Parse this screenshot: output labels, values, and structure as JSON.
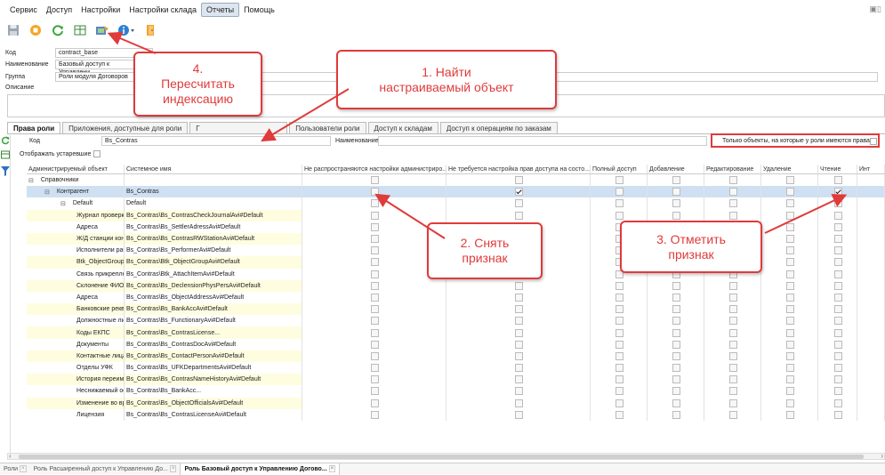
{
  "menu": [
    "Сервис",
    "Доступ",
    "Настройки",
    "Настройки склада",
    "Отчеты",
    "Помощь"
  ],
  "menu_active": "Отчеты",
  "toolbar_icons": [
    "save-icon",
    "stop-icon",
    "refresh-icon",
    "table-icon",
    "reindex-icon",
    "info-icon",
    "door-icon"
  ],
  "form": {
    "code_label": "Код",
    "code_value": "contract_base",
    "name_label": "Наименование",
    "name_value": "Базовый доступ к Управлени",
    "group_label": "Группа",
    "group_value": "Роли модуля Договоров",
    "desc_label": "Описание"
  },
  "tabs": [
    "Права роли",
    "Приложения, доступные для роли",
    "Г",
    "Пользователи роли",
    "Доступ к складам",
    "Доступ к операциям по заказам"
  ],
  "filter": {
    "code_label": "Код",
    "code_value": "Bs_Contras",
    "name_label": "Наименование",
    "only_objects_label": "Только объекты, на которые у роли имеются права",
    "show_outdated_label": "Отображать устаревшие"
  },
  "columns": [
    "Администрируемый объект",
    "Системное имя",
    "Не распространяются настройки администриро...",
    "Не требуется настройка прав доступа на состо...",
    "Полный доступ",
    "Добавление",
    "Редактирование",
    "Удаление",
    "Чтение",
    "Инт"
  ],
  "rows": [
    {
      "name": "Справочники",
      "sys": "",
      "indent": 0,
      "expand": "⊟",
      "cbs": [
        0,
        0,
        0,
        0,
        0,
        0,
        0
      ],
      "style": "plain"
    },
    {
      "name": "Контрагент",
      "sys": "Bs_Contras",
      "indent": 1,
      "expand": "⊟",
      "cbs": [
        0,
        1,
        0,
        0,
        0,
        0,
        1
      ],
      "style": "sel"
    },
    {
      "name": "Default",
      "sys": "Default",
      "indent": 2,
      "expand": "⊟",
      "cbs": [
        0,
        0,
        0,
        0,
        0,
        0,
        0
      ],
      "style": "plain"
    },
    {
      "name": "Журнал проверки конт",
      "sys": "Bs_Contras\\Bs_ContrasCheckJournalAvi#Default",
      "indent": 3,
      "expand": "",
      "cbs": [
        0,
        0,
        0,
        0,
        0,
        0,
        0
      ],
      "style": "yellow"
    },
    {
      "name": "Адреса",
      "sys": "Bs_Contras\\Bs_SettlerAdressAvi#Default",
      "indent": 3,
      "expand": "",
      "cbs": [
        0,
        0,
        0,
        0,
        0,
        0,
        0
      ],
      "style": "plain"
    },
    {
      "name": "Ж/Д станции контраген",
      "sys": "Bs_Contras\\Bs_ContrasRWStationAvi#Default",
      "indent": 3,
      "expand": "",
      "cbs": [
        0,
        0,
        0,
        0,
        0,
        0,
        0
      ],
      "style": "yellow"
    },
    {
      "name": "Исполнители работ",
      "sys": "Bs_Contras\\Bs_PerformerAvi#Default",
      "indent": 3,
      "expand": "",
      "cbs": [
        0,
        0,
        0,
        0,
        0,
        0,
        0
      ],
      "style": "plain"
    },
    {
      "name": "Btk_ObjectGroupAvi#Def",
      "sys": "Bs_Contras\\Btk_ObjectGroupAvi#Default",
      "indent": 3,
      "expand": "",
      "cbs": [
        0,
        0,
        0,
        0,
        0,
        0,
        0
      ],
      "style": "yellow"
    },
    {
      "name": "Связь прикрепленного",
      "sys": "Bs_Contras\\Btk_AttachItemAvi#Default",
      "indent": 3,
      "expand": "",
      "cbs": [
        0,
        0,
        0,
        0,
        0,
        0,
        0
      ],
      "style": "plain"
    },
    {
      "name": "Склонение ФИО физич",
      "sys": "Bs_Contras\\Bs_DeclensionPhysPersAvi#Default",
      "indent": 3,
      "expand": "",
      "cbs": [
        0,
        0,
        0,
        0,
        0,
        0,
        0
      ],
      "style": "yellow"
    },
    {
      "name": "Адреса",
      "sys": "Bs_Contras\\Bs_ObjectAddressAvi#Default",
      "indent": 3,
      "expand": "",
      "cbs": [
        0,
        0,
        0,
        0,
        0,
        0,
        0
      ],
      "style": "plain"
    },
    {
      "name": "Банковские реквизиты",
      "sys": "Bs_Contras\\Bs_BankAccAvi#Default",
      "indent": 3,
      "expand": "",
      "cbs": [
        0,
        0,
        0,
        0,
        0,
        0,
        0
      ],
      "style": "yellow"
    },
    {
      "name": "Должностные лица",
      "sys": "Bs_Contras\\Bs_FunctionaryAvi#Default",
      "indent": 3,
      "expand": "",
      "cbs": [
        0,
        0,
        0,
        0,
        0,
        0,
        0
      ],
      "style": "plain"
    },
    {
      "name": "Коды ЕКПС",
      "sys": "Bs_Contras\\Bs_ContrasLicense...",
      "indent": 3,
      "expand": "",
      "cbs": [
        0,
        0,
        0,
        0,
        0,
        0,
        0
      ],
      "style": "yellow"
    },
    {
      "name": "Документы",
      "sys": "Bs_Contras\\Bs_ContrasDocAvi#Default",
      "indent": 3,
      "expand": "",
      "cbs": [
        0,
        0,
        0,
        0,
        0,
        0,
        0
      ],
      "style": "plain"
    },
    {
      "name": "Контактные лица",
      "sys": "Bs_Contras\\Bs_ContactPersonAvi#Default",
      "indent": 3,
      "expand": "",
      "cbs": [
        0,
        0,
        0,
        0,
        0,
        0,
        0
      ],
      "style": "yellow"
    },
    {
      "name": "Отделы УФК",
      "sys": "Bs_Contras\\Bs_UFKDepartmentsAvi#Default",
      "indent": 3,
      "expand": "",
      "cbs": [
        0,
        0,
        0,
        0,
        0,
        0,
        0
      ],
      "style": "plain"
    },
    {
      "name": "История переименован",
      "sys": "Bs_Contras\\Bs_ContrasNameHistoryAvi#Default",
      "indent": 3,
      "expand": "",
      "cbs": [
        0,
        0,
        0,
        0,
        0,
        0,
        0
      ],
      "style": "yellow"
    },
    {
      "name": "Неснижаемый остаток",
      "sys": "Bs_Contras\\Bs_BankAcc...",
      "indent": 3,
      "expand": "",
      "cbs": [
        0,
        0,
        0,
        0,
        0,
        0,
        0
      ],
      "style": "plain"
    },
    {
      "name": "Изменение во времени",
      "sys": "Bs_Contras\\Bs_ObjectOfficialsAvi#Default",
      "indent": 3,
      "expand": "",
      "cbs": [
        0,
        0,
        0,
        0,
        0,
        0,
        0
      ],
      "style": "yellow"
    },
    {
      "name": "Лицензия",
      "sys": "Bs_Contras\\Bs_ContrasLicenseAvi#Default",
      "indent": 3,
      "expand": "",
      "cbs": [
        0,
        0,
        0,
        0,
        0,
        0,
        0
      ],
      "style": "plain"
    }
  ],
  "bottom_tabs": [
    {
      "label": "Роли",
      "active": false
    },
    {
      "label": "Роль Расширенный доступ к Управлению До...",
      "active": false
    },
    {
      "label": "Роль Базовый доступ к Управлению Догово...",
      "active": true
    }
  ],
  "callouts": {
    "c4": "4.\nПересчитать\nиндексацию",
    "c1": "1. Найти\nнастраиваемый объект",
    "c2": "2. Снять\nпризнак",
    "c3": "3. Отметить\nпризнак"
  },
  "colors": {
    "annotation": "#e03a3a",
    "selected_row": "#cfe0f2",
    "highlight_row": "#fffde0"
  }
}
